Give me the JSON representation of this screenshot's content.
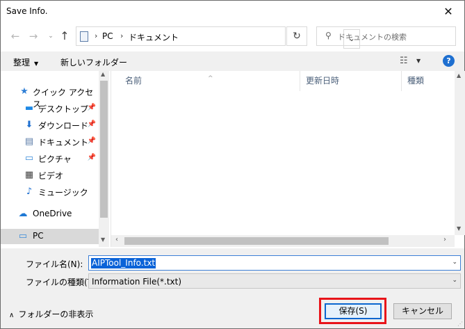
{
  "window": {
    "title": "Save Info.",
    "close_glyph": "✕"
  },
  "nav": {
    "back_glyph": "←",
    "forward_glyph": "→",
    "recent_glyph": "⌄",
    "up_glyph": "↑",
    "breadcrumb": [
      "PC",
      "ドキュメント"
    ],
    "separator": "›",
    "address_dropdown_glyph": "⌄",
    "refresh_glyph": "↻",
    "search_placeholder": "ドキュメントの検索",
    "search_glyph": "⚲"
  },
  "toolbar": {
    "organize_label": "整理",
    "caret": "▼",
    "new_folder_label": "新しいフォルダー",
    "view_glyph": "☷",
    "help_glyph": "?"
  },
  "sidebar": {
    "items": [
      {
        "label": "クイック アクセス",
        "icon": "star-icon",
        "glyph": "★",
        "color": "#2f7fd6",
        "pinned": false
      },
      {
        "label": "デスクトップ",
        "icon": "desktop-icon",
        "glyph": "▬",
        "color": "#1e88e5",
        "pinned": true
      },
      {
        "label": "ダウンロード",
        "icon": "download-icon",
        "glyph": "⬇",
        "color": "#1e6fd0",
        "pinned": true
      },
      {
        "label": "ドキュメント",
        "icon": "document-icon",
        "glyph": "▤",
        "color": "#5b7ca8",
        "pinned": true
      },
      {
        "label": "ピクチャ",
        "icon": "pictures-icon",
        "glyph": "▭",
        "color": "#3a8bd9",
        "pinned": true
      },
      {
        "label": "ビデオ",
        "icon": "video-icon",
        "glyph": "▦",
        "color": "#444444",
        "pinned": false
      },
      {
        "label": "ミュージック",
        "icon": "music-icon",
        "glyph": "♪",
        "color": "#1e6fd0",
        "pinned": false
      },
      {
        "label": "OneDrive",
        "icon": "cloud-icon",
        "glyph": "☁",
        "color": "#1e78d4",
        "pinned": false
      },
      {
        "label": "PC",
        "icon": "computer-icon",
        "glyph": "▭",
        "color": "#3a8bd9",
        "pinned": false
      }
    ],
    "pin_glyph": "📌"
  },
  "file_list": {
    "columns": [
      "名前",
      "更新日時",
      "種類"
    ],
    "sort_glyph": "^",
    "rows": []
  },
  "form": {
    "filename_label": "ファイル名(N):",
    "filename_value": "AIPTool_Info.txt",
    "filetype_label": "ファイルの種類(T):",
    "filetype_value": "Information File(*.txt)",
    "dropdown_glyph": "⌄"
  },
  "footer": {
    "hide_folders_label": "フォルダーの非表示",
    "hide_glyph": "∧",
    "save_label": "保存(S)",
    "cancel_label": "キャンセル"
  },
  "colors": {
    "accent": "#0a63d8",
    "highlight_border": "#e8141a",
    "panel_bg": "#f0f0f0"
  }
}
